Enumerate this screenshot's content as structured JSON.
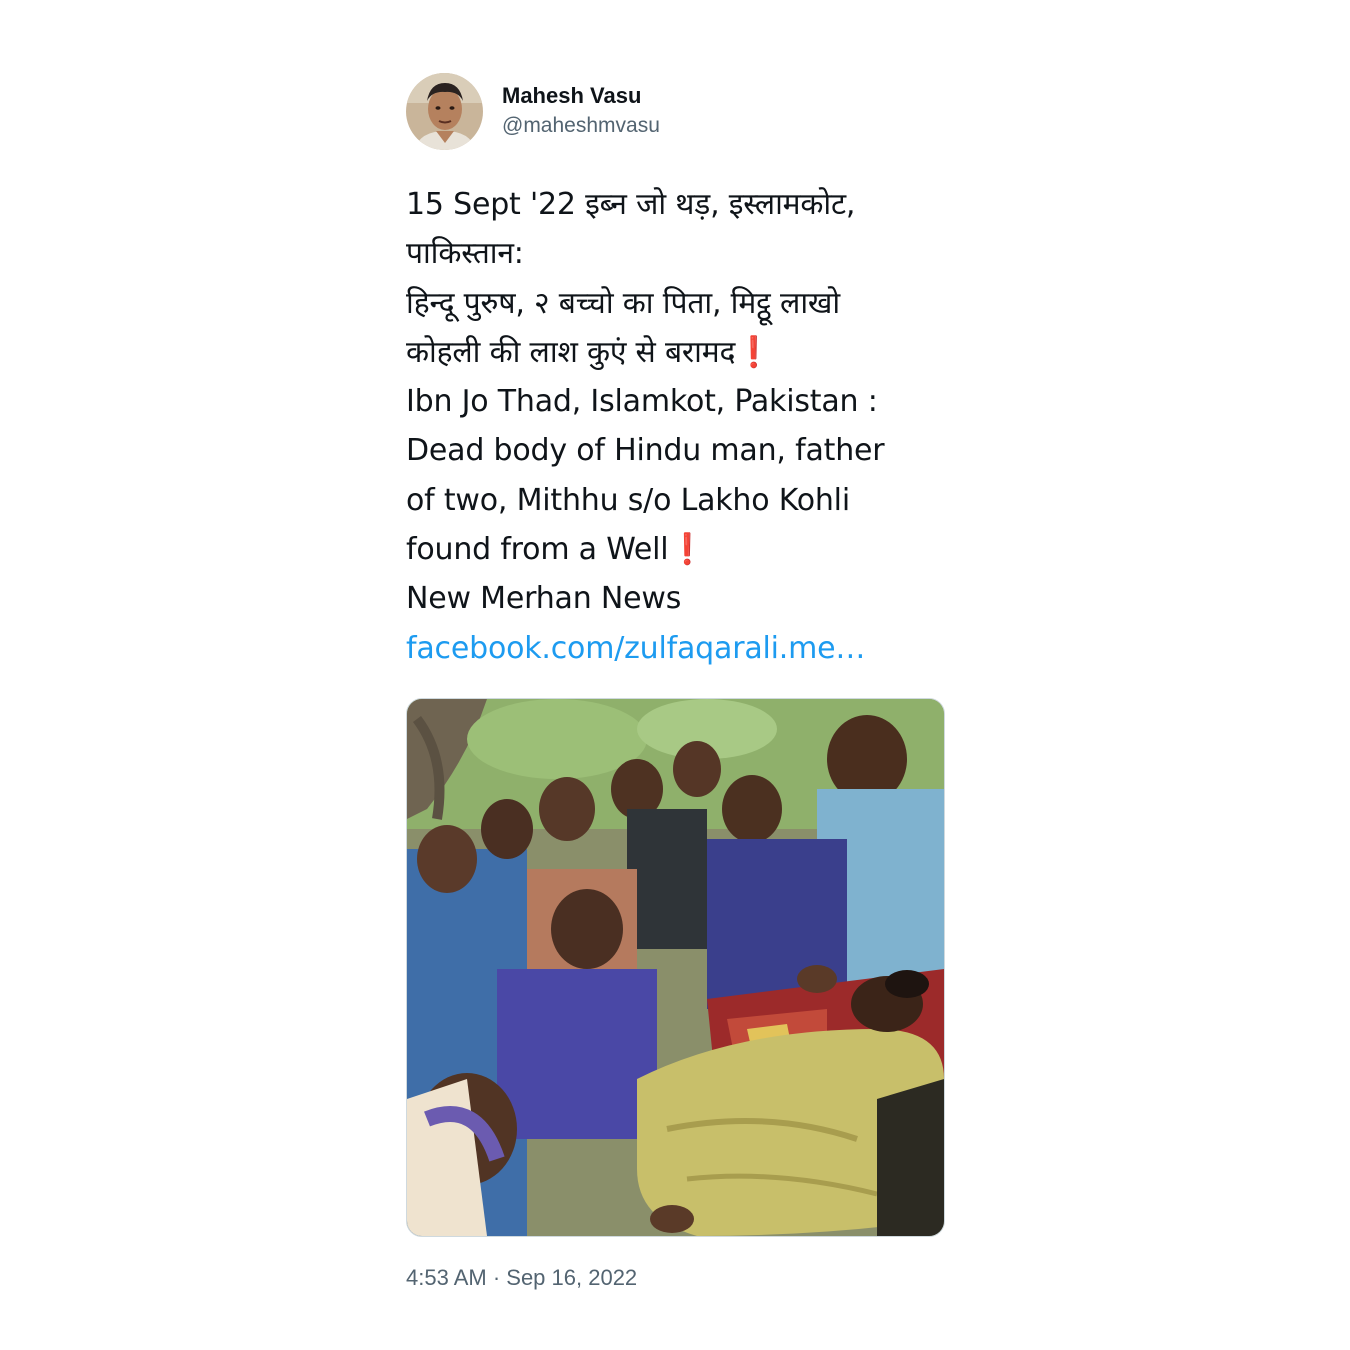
{
  "author": {
    "display_name": "Mahesh Vasu",
    "handle": "@maheshmvasu",
    "avatar_icon": "profile-photo"
  },
  "tweet": {
    "lines": [
      "15 Sept '22 इब्न जो थड़, इस्लामकोट,",
      "पाकिस्तान:",
      "हिन्दू पुरुष, २ बच्चो का पिता, मिट्ठू लाखो",
      "कोहली की लाश कुएं से बरामद",
      "Ibn Jo Thad, Islamkot, Pakistan :",
      "Dead body of Hindu man, father",
      "of two, Mithhu s/o Lakho Kohli",
      "found from a Well",
      "New Merhan News"
    ],
    "exclamation": "❗",
    "link_text": "facebook.com/zulfaqarali.me…",
    "timestamp": "4:53 AM · Sep 16, 2022"
  },
  "media": {
    "description_icon": "attached-photo"
  },
  "colors": {
    "link": "#1d9bf0",
    "secondary_text": "#536471",
    "exclamation": "#d0202a"
  }
}
